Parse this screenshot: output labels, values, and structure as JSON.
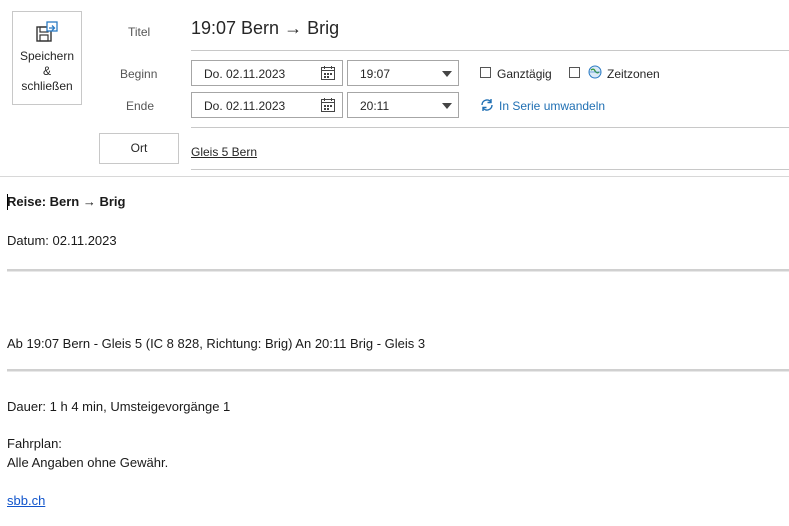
{
  "toolbar": {
    "save_label_line1": "Speichern",
    "save_label_line2": "&",
    "save_label_line3": "schließen"
  },
  "fields": {
    "title_label": "Titel",
    "title_value": "19:07 Bern → Brig",
    "start_label": "Beginn",
    "end_label": "Ende",
    "start_date": "Do. 02.11.2023",
    "start_time": "19:07",
    "end_date": "Do. 02.11.2023",
    "end_time": "20:11",
    "all_day_label": "Ganztägig",
    "timezones_label": "Zeitzonen",
    "series_label": "In Serie umwandeln",
    "location_button": "Ort",
    "location_value": "Gleis 5 Bern"
  },
  "body": {
    "heading": "Reise: Bern → Brig",
    "date_line": "Datum: 02.11.2023",
    "connection_line": "Ab 19:07 Bern - Gleis 5 (IC 8 828, Richtung: Brig) An 20:11 Brig - Gleis 3",
    "duration_line": "Dauer: 1 h 4 min, Umsteigevorgänge 1",
    "timetable_label": "Fahrplan:",
    "disclaimer": "Alle Angaben ohne Gewähr.",
    "link_text": "sbb.ch"
  },
  "icons": {
    "save": "save-close-icon",
    "calendar": "calendar-icon",
    "dropdown": "chevron-down-icon",
    "globe": "globe-icon",
    "series": "refresh-icon"
  },
  "colors": {
    "accent": "#1f6fb3",
    "link": "#1155cc"
  }
}
